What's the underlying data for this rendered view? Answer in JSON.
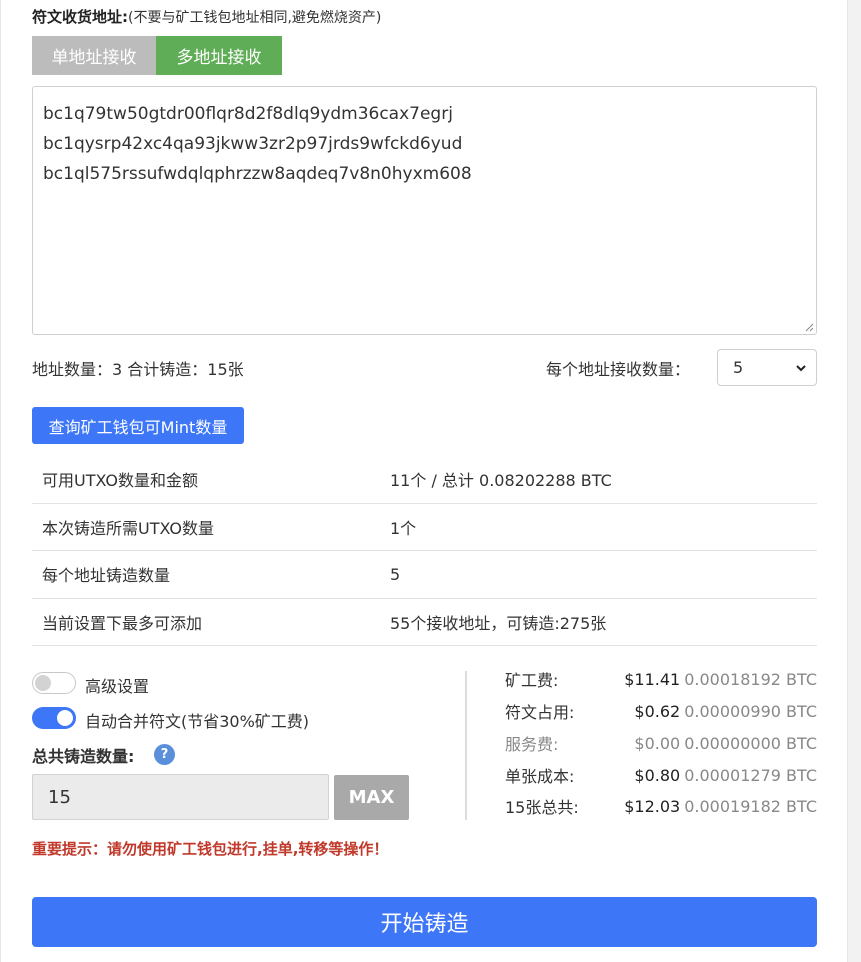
{
  "header": {
    "title": "符文收货地址:",
    "note": "(不要与矿工钱包地址相同,避免燃烧资产)"
  },
  "tabs": [
    {
      "label": "单地址接收",
      "active": false
    },
    {
      "label": "多地址接收",
      "active": true
    }
  ],
  "addresses": [
    "bc1q79tw50gtdr00flqr8d2f8dlq9ydm36cax7egrj",
    "bc1qysrp42xc4qa93jkww3zr2p97jrds9wfckd6yud",
    "bc1ql575rssufwdqlqphrzzw8aqdeq7v8n0hyxm608"
  ],
  "stats": {
    "text": "地址数量：3   合计铸造：15张",
    "per_address_label": "每个地址接收数量：",
    "per_address_value": "5"
  },
  "query_button": "查询矿工钱包可Mint数量",
  "info_rows": [
    {
      "key": "可用UTXO数量和金额",
      "value": "11个 / 总计 0.08202288 BTC"
    },
    {
      "key": "本次铸造所需UTXO数量",
      "value": "1个"
    },
    {
      "key": "每个地址铸造数量",
      "value": "5"
    },
    {
      "key": "当前设置下最多可添加",
      "value": "55个接收地址，可铸造:275张"
    }
  ],
  "settings": {
    "advanced_label": "高级设置",
    "advanced_on": false,
    "merge_label": "自动合并符文(节省30%矿工费)",
    "merge_on": true,
    "total_label": "总共铸造数量:",
    "help_symbol": "?",
    "total_value": "15",
    "max_label": "MAX"
  },
  "fees": [
    {
      "label": "矿工费:",
      "usd": "$11.41",
      "btc": "0.00018192 BTC",
      "muted": false
    },
    {
      "label": "符文占用:",
      "usd": "$0.62",
      "btc": "0.00000990 BTC",
      "muted": false
    },
    {
      "label": "服务费:",
      "usd": "$0.00",
      "btc": "0.00000000 BTC",
      "muted": true
    },
    {
      "label": "单张成本:",
      "usd": "$0.80",
      "btc": "0.00001279 BTC",
      "muted": false
    },
    {
      "label": "15张总共:",
      "usd": "$12.03",
      "btc": "0.00019182 BTC",
      "muted": false
    }
  ],
  "warning": "重要提示：请勿使用矿工钱包进行,挂单,转移等操作！",
  "start_button": "开始铸造",
  "colors": {
    "primary": "#3d76f6",
    "active_tab": "#5fad56",
    "inactive_tab": "#bcbcbc",
    "warning": "#c0392b"
  }
}
